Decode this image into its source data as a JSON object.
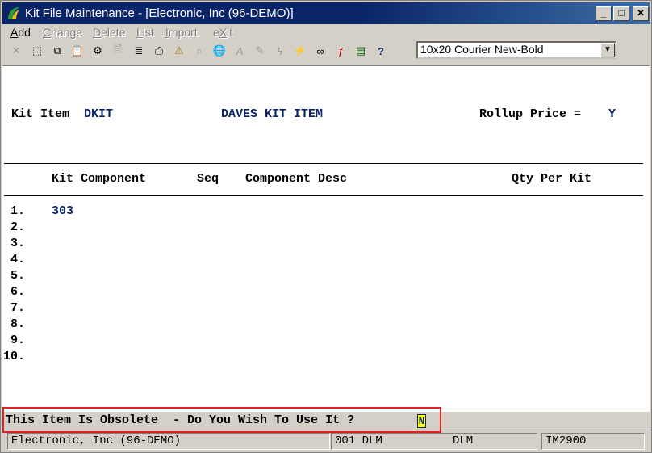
{
  "window": {
    "title": "Kit File Maintenance - [Electronic, Inc (96-DEMO)]",
    "controls": {
      "minimize": "_",
      "maximize": "□",
      "close": "✕"
    }
  },
  "menu": {
    "items": [
      {
        "label": "Add",
        "key": "A",
        "rest": "dd",
        "enabled": true
      },
      {
        "label": "Change",
        "key": "C",
        "rest": "hange",
        "enabled": false
      },
      {
        "label": "Delete",
        "key": "D",
        "rest": "elete",
        "enabled": false
      },
      {
        "label": "List",
        "key": "L",
        "rest": "ist",
        "enabled": false
      },
      {
        "label": "Import",
        "key": "I",
        "rest": "mport",
        "enabled": false
      },
      {
        "label": "eXit",
        "pre": "e",
        "key": "X",
        "rest": "it",
        "enabled": false
      }
    ]
  },
  "toolbar": {
    "font_select": {
      "value": "10x20 Courier New-Bold",
      "arrow": "▼"
    },
    "icons": [
      {
        "name": "cancel-icon",
        "glyph": "✕",
        "enabled": false
      },
      {
        "name": "select-icon",
        "glyph": "⬚",
        "enabled": true
      },
      {
        "name": "copy-icon",
        "glyph": "⧉",
        "enabled": true
      },
      {
        "name": "paste-icon",
        "glyph": "📋",
        "enabled": true
      },
      {
        "name": "settings-icon",
        "glyph": "⚙",
        "enabled": true
      },
      {
        "name": "properties-icon",
        "glyph": "🗎",
        "enabled": false
      },
      {
        "name": "notes-icon",
        "glyph": "≣",
        "enabled": true
      },
      {
        "name": "print-icon",
        "glyph": "⎙",
        "enabled": true
      },
      {
        "name": "alert-icon",
        "glyph": "⚠",
        "enabled": true
      },
      {
        "name": "find-icon",
        "glyph": "⌕",
        "enabled": false
      },
      {
        "name": "globe-icon",
        "glyph": "🌐",
        "enabled": true
      },
      {
        "name": "font-icon",
        "glyph": "A",
        "enabled": false
      },
      {
        "name": "edit-icon",
        "glyph": "✎",
        "enabled": false
      },
      {
        "name": "flash-icon",
        "glyph": "ϟ",
        "enabled": false
      },
      {
        "name": "run-icon",
        "glyph": "⚡",
        "enabled": true
      },
      {
        "name": "link-icon",
        "glyph": "∞",
        "enabled": true
      },
      {
        "name": "function-icon",
        "glyph": "ƒ",
        "enabled": true
      },
      {
        "name": "calculator-icon",
        "glyph": "▤",
        "enabled": true
      },
      {
        "name": "help-icon",
        "glyph": "?",
        "enabled": true
      }
    ]
  },
  "form": {
    "kit_item_label": "Kit Item",
    "kit_item_value": "DKIT",
    "kit_item_desc": "DAVES KIT ITEM",
    "rollup_label": "Rollup Price =",
    "rollup_value": "Y",
    "columns": {
      "component": "Kit Component",
      "seq": "Seq",
      "desc": "Component Desc",
      "qty": "Qty Per Kit"
    },
    "rows": [
      {
        "num": " 1.",
        "component": "303"
      },
      {
        "num": " 2.",
        "component": ""
      },
      {
        "num": " 3.",
        "component": ""
      },
      {
        "num": " 4.",
        "component": ""
      },
      {
        "num": " 5.",
        "component": ""
      },
      {
        "num": " 6.",
        "component": ""
      },
      {
        "num": " 7.",
        "component": ""
      },
      {
        "num": " 8.",
        "component": ""
      },
      {
        "num": " 9.",
        "component": ""
      },
      {
        "num": "10.",
        "component": ""
      }
    ]
  },
  "prompt": {
    "text": "This Item Is Obsolete  - Do You Wish To Use It ?",
    "value": "N"
  },
  "statusbar": {
    "company": "Electronic, Inc (96-DEMO)",
    "user": "001 DLM",
    "initials": "DLM",
    "program": "IM2900"
  },
  "colors": {
    "titlebar": "#0a246a",
    "field_value": "#0a246a",
    "highlight": "#e02020",
    "input_bg": "#ffff00"
  }
}
